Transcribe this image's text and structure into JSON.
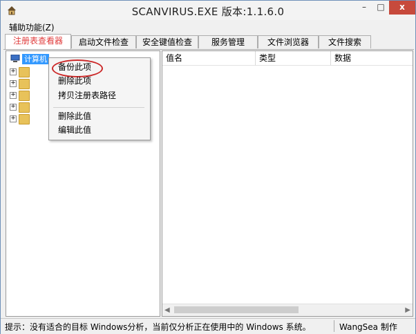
{
  "window": {
    "title": "SCANVIRUS.EXE 版本:1.1.6.0",
    "minimize": "–",
    "maximize": "□",
    "close": "x"
  },
  "menu": {
    "items": [
      {
        "label": "辅助功能(Z)"
      }
    ]
  },
  "tabs": [
    {
      "label": "注册表查看器",
      "active": true
    },
    {
      "label": "启动文件检查",
      "active": false
    },
    {
      "label": "安全键值检查",
      "active": false
    },
    {
      "label": "服务管理",
      "active": false
    },
    {
      "label": "文件浏览器",
      "active": false
    },
    {
      "label": "文件搜索",
      "active": false
    }
  ],
  "tree": {
    "root_label": "计算机"
  },
  "list": {
    "columns": [
      "值名",
      "类型",
      "数据"
    ]
  },
  "context_menu": {
    "items": [
      {
        "label": "备份此项",
        "highlighted": true
      },
      {
        "label": "删除此项"
      },
      {
        "label": "拷贝注册表路径"
      },
      {
        "label": "删除此值"
      },
      {
        "label": "编辑此值"
      }
    ]
  },
  "status": {
    "hint": "提示：没有适合的目标 Windows分析，当前仅分析正在使用中的 Windows 系统。",
    "author": "WangSea 制作"
  },
  "colors": {
    "active_tab_text": "#e03c3c",
    "selection": "#3399ff",
    "highlight_ring": "#cc2a2a",
    "close_button": "#c74a3c"
  }
}
